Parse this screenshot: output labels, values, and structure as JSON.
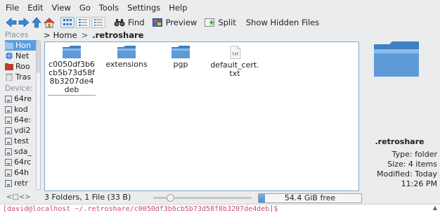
{
  "menubar": {
    "items": [
      {
        "label": "File"
      },
      {
        "label": "Edit"
      },
      {
        "label": "View"
      },
      {
        "label": "Go"
      },
      {
        "label": "Tools"
      },
      {
        "label": "Settings"
      },
      {
        "label": "Help"
      }
    ]
  },
  "toolbar": {
    "back_icon": "arrow-left-icon",
    "forward_icon": "arrow-right-icon",
    "up_icon": "arrow-up-icon",
    "home_icon": "home-icon",
    "find_label": "Find",
    "preview_label": "Preview",
    "split_label": "Split",
    "show_hidden_label": "Show Hidden Files"
  },
  "places": {
    "title": "Places",
    "items": [
      {
        "label": "Hon",
        "icon": "home-folder-icon",
        "selected": true
      },
      {
        "label": "Net",
        "icon": "network-icon"
      },
      {
        "label": "Roo",
        "icon": "root-folder-icon"
      },
      {
        "label": "Tras",
        "icon": "trash-icon"
      }
    ],
    "devices_title": "Device:",
    "devices": [
      {
        "label": "64re"
      },
      {
        "label": "kod"
      },
      {
        "label": "64e:"
      },
      {
        "label": "vdi2"
      },
      {
        "label": "test"
      },
      {
        "label": "sda_"
      },
      {
        "label": "64rc"
      },
      {
        "label": "64h"
      },
      {
        "label": "retr"
      }
    ]
  },
  "breadcrumb": {
    "home": "Home",
    "separator": ">",
    "current": ".retroshare"
  },
  "files": [
    {
      "name": "c0050df3b6cb5b73d58f8b3207de4deb",
      "type": "folder",
      "selected": true
    },
    {
      "name": "extensions",
      "type": "folder"
    },
    {
      "name": "pgp",
      "type": "folder"
    },
    {
      "name": "default_cert.txt",
      "type": "text",
      "icon_label": "txt"
    }
  ],
  "info": {
    "name": ".retroshare",
    "type_key": "Type:",
    "type_val": "folder",
    "size_key": "Size:",
    "size_val": "4 items",
    "modified_key": "Modified:",
    "modified_val": "Today",
    "modified_time": "11:26 PM"
  },
  "status": {
    "nav": "<□<>",
    "text": "3 Folders, 1 File (33 B)",
    "zoom_level": 0.17,
    "space_used_fraction": 0.06,
    "space_label": "54.4 GiB free"
  },
  "terminal": {
    "prompt": "[david@localhost ~/.retroshare/c0050df3b6cb5b73d58f8b3207de4deb]$"
  },
  "colors": {
    "folder": "#5d9ad8",
    "selection": "#5c9ee0",
    "frame": "#7ba6d6",
    "terminal_prompt": "#c94c7a"
  }
}
